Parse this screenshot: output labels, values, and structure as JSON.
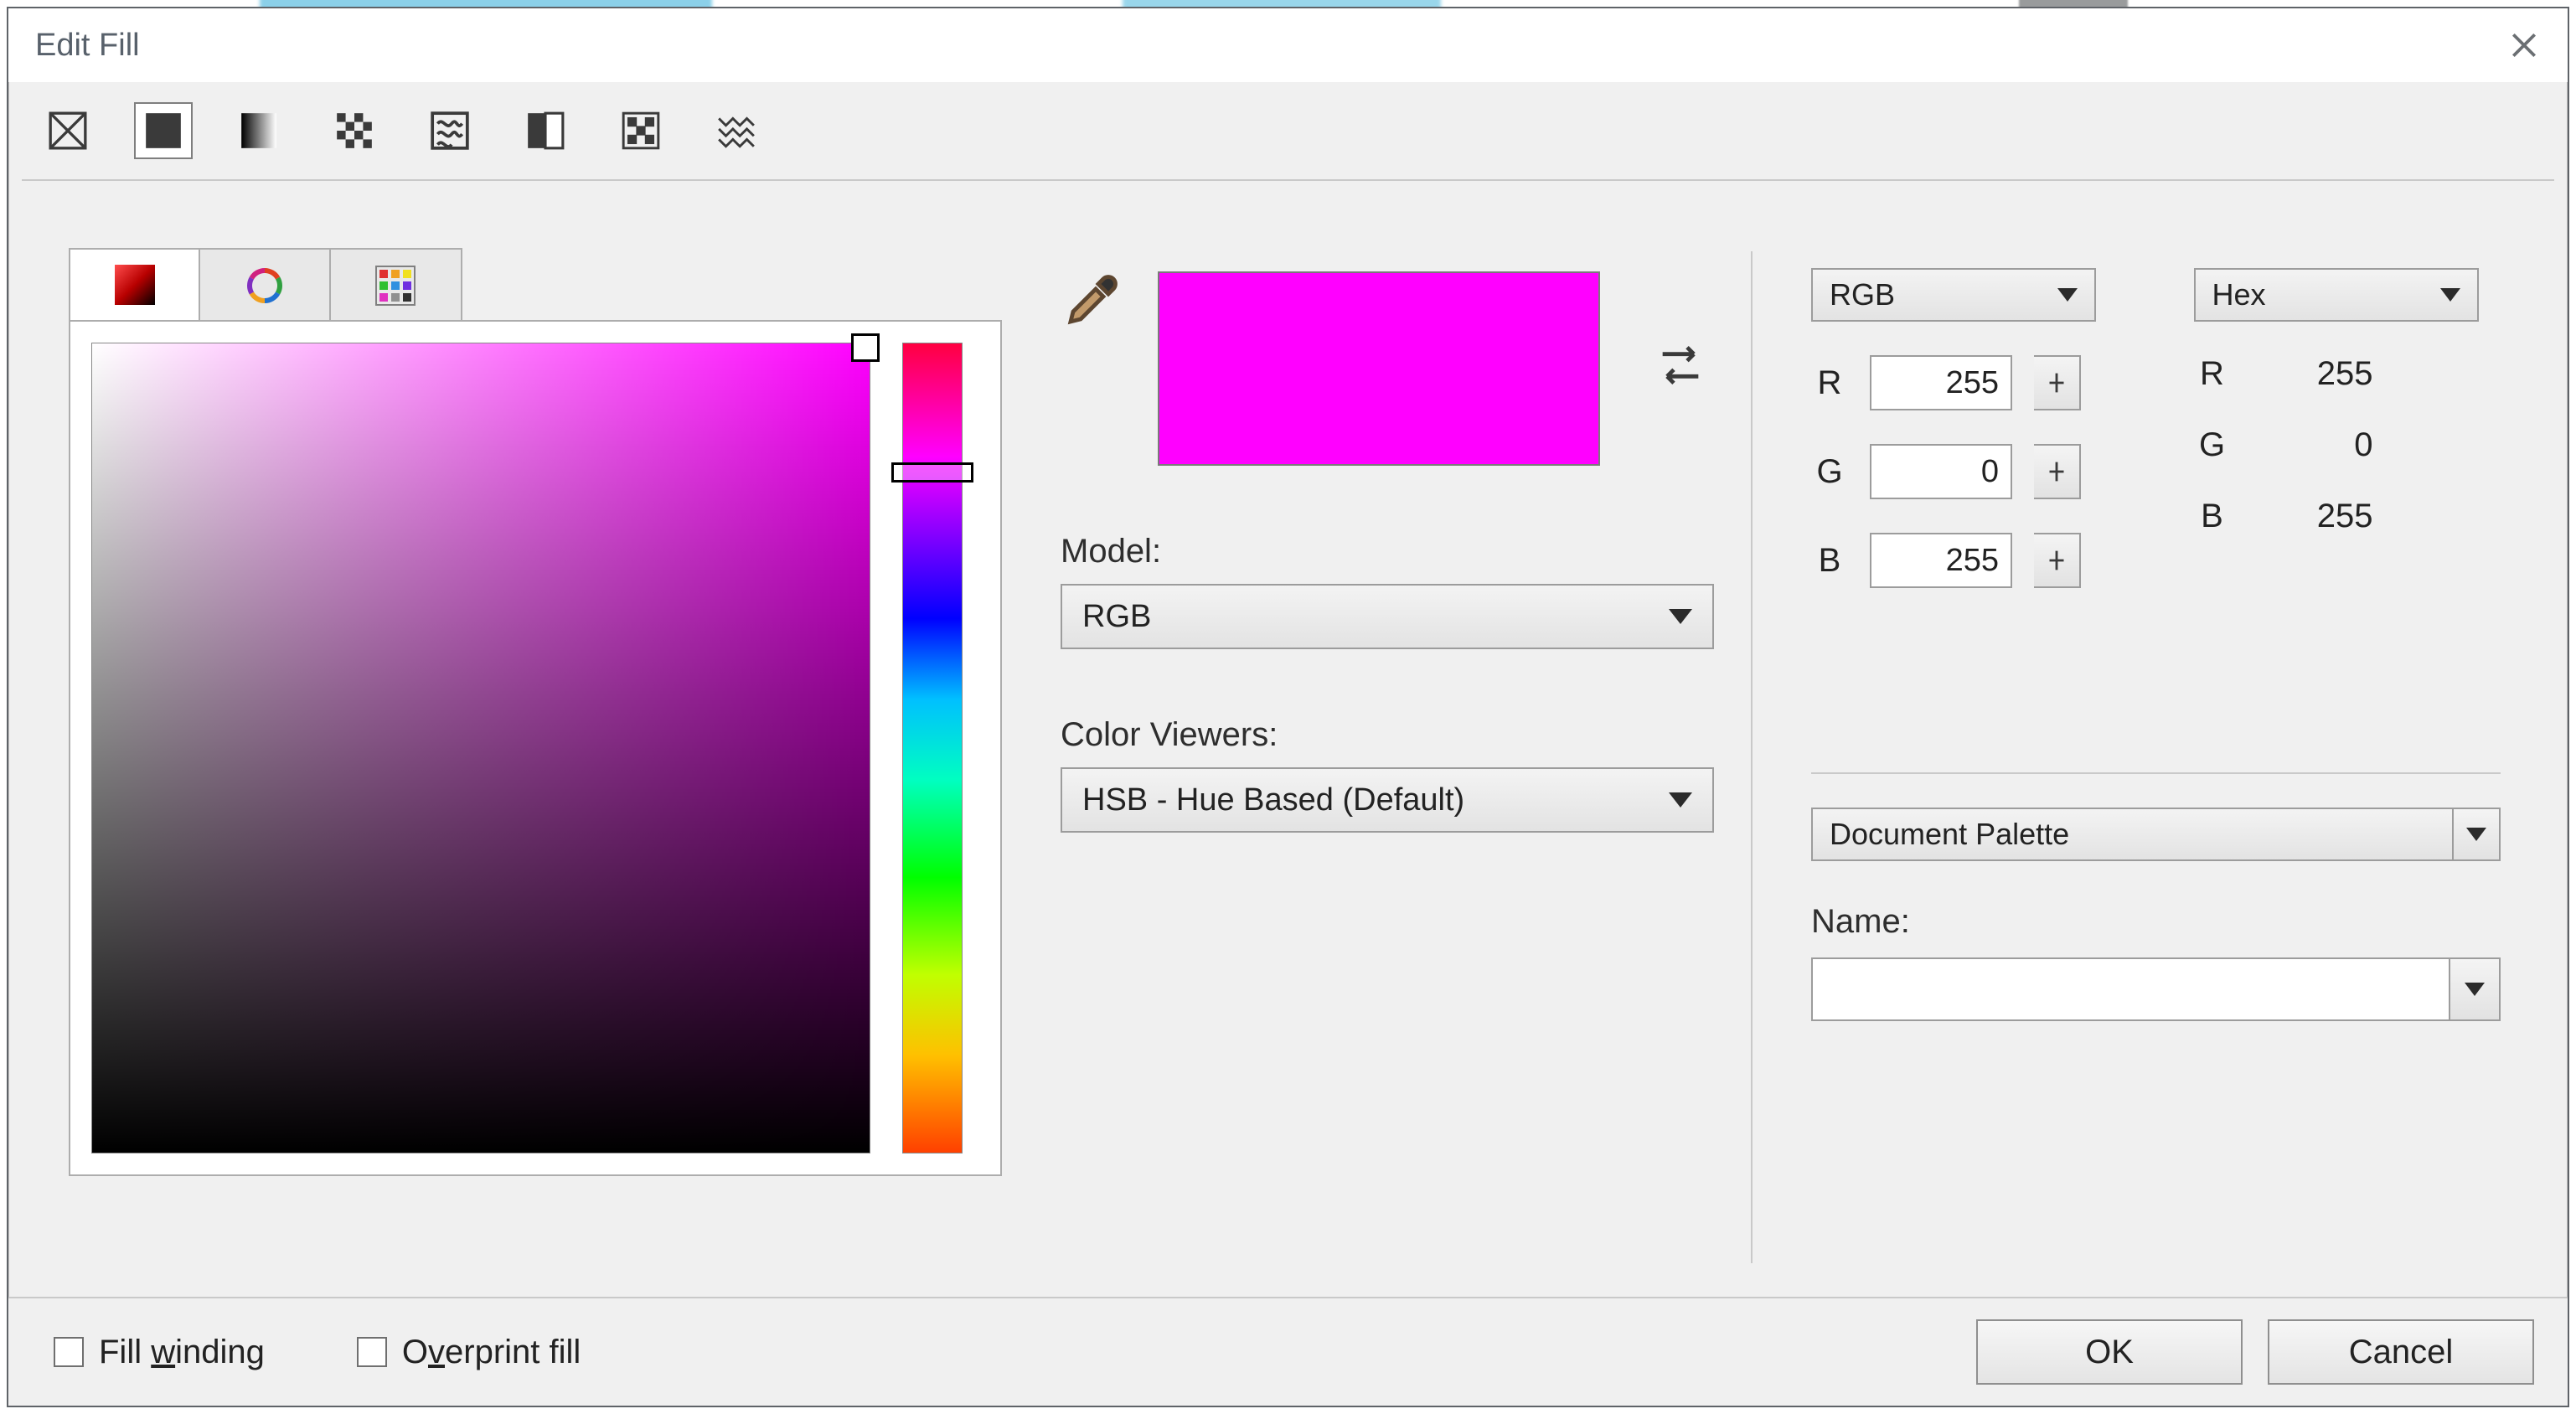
{
  "window": {
    "title": "Edit Fill"
  },
  "fillTypes": [
    {
      "id": "no-fill",
      "selected": false
    },
    {
      "id": "uniform-fill",
      "selected": true
    },
    {
      "id": "fountain-fill",
      "selected": false
    },
    {
      "id": "pattern-fill",
      "selected": false
    },
    {
      "id": "texture-fill",
      "selected": false
    },
    {
      "id": "two-color-fill",
      "selected": false
    },
    {
      "id": "bitmap-pattern",
      "selected": false
    },
    {
      "id": "postscript-fill",
      "selected": false
    }
  ],
  "viewerTabs": [
    {
      "id": "color-viewer",
      "active": true
    },
    {
      "id": "color-wheel",
      "active": false
    },
    {
      "id": "palette-grid",
      "active": false
    }
  ],
  "swatch": {
    "colorHex": "#ff00ff"
  },
  "modelLabel": "Model:",
  "modelValue": "RGB",
  "viewersLabel": "Color Viewers:",
  "viewersValue": "HSB - Hue Based (Default)",
  "colorSpaceLeft": {
    "label": "RGB"
  },
  "colorSpaceRight": {
    "label": "Hex"
  },
  "rgb": {
    "r": {
      "k": "R",
      "v": "255"
    },
    "g": {
      "k": "G",
      "v": "0"
    },
    "b": {
      "k": "B",
      "v": "255"
    }
  },
  "hex": {
    "r": {
      "k": "R",
      "v": "255"
    },
    "g": {
      "k": "G",
      "v": "0"
    },
    "b": {
      "k": "B",
      "v": "255"
    }
  },
  "paletteLabel": "Document Palette",
  "nameLabel": "Name:",
  "nameValue": "",
  "checkboxes": {
    "fillWinding": {
      "pre": "Fill ",
      "u": "w",
      "post": "inding"
    },
    "overprint": {
      "pre": "O",
      "u": "v",
      "post": "erprint fill"
    }
  },
  "buttons": {
    "ok": "OK",
    "cancel": "Cancel"
  }
}
